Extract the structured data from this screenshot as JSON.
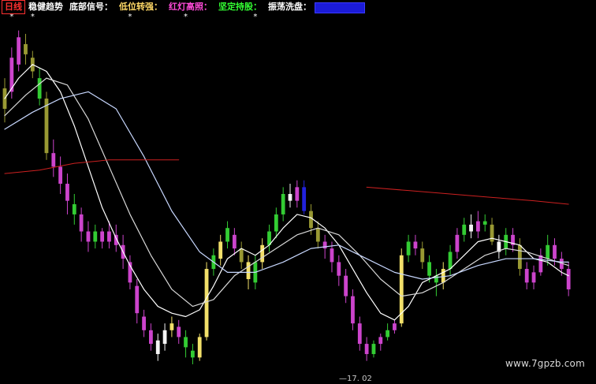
{
  "legend": [
    {
      "label": "日线",
      "color": "#ff3030",
      "box": true
    },
    {
      "label": "稳健趋势",
      "color": "#ffffff"
    },
    {
      "label": "底部信号：",
      "color": "#ffffff"
    },
    {
      "label": "低位转强：",
      "color": "#ffd966"
    },
    {
      "label": "红灯高照：",
      "color": "#ff4ad8"
    },
    {
      "label": "坚定持股：",
      "color": "#33ff33"
    },
    {
      "label": "振荡洗盘：",
      "color": "#ffffff"
    },
    {
      "label": "",
      "color": "#2222ff",
      "filled": true
    }
  ],
  "watermark": "www.7gpzb.com",
  "axis_label": "—17. 02",
  "chart_data": {
    "type": "candlestick",
    "colors": {
      "background": "#000000",
      "ma_white": "#ffffff",
      "ma_light": "#d8d8d8",
      "ma_blue": "#c8d8ff",
      "ma_red": "#cc2020",
      "magenta": "#cc44cc",
      "yellow": "#f2e06a",
      "green": "#33cc33",
      "olive": "#999933",
      "blue": "#2222dd",
      "white_candle": "#f5f5f5"
    },
    "x_range": [
      0,
      150
    ],
    "y_range": [
      0,
      100
    ],
    "candles": [
      {
        "x": 0,
        "o": 75,
        "c": 81,
        "h": 84,
        "l": 71,
        "color": "olive"
      },
      {
        "x": 1,
        "o": 80,
        "c": 90,
        "h": 93,
        "l": 78,
        "color": "magenta"
      },
      {
        "x": 2,
        "o": 88,
        "c": 96,
        "h": 98,
        "l": 86,
        "color": "magenta"
      },
      {
        "x": 3,
        "o": 94,
        "c": 91,
        "h": 97,
        "l": 88,
        "color": "olive"
      },
      {
        "x": 4,
        "o": 90,
        "c": 86,
        "h": 92,
        "l": 84,
        "color": "olive"
      },
      {
        "x": 5,
        "o": 84,
        "c": 78,
        "h": 87,
        "l": 76,
        "color": "green"
      },
      {
        "x": 6,
        "o": 78,
        "c": 62,
        "h": 80,
        "l": 60,
        "color": "olive"
      },
      {
        "x": 7,
        "o": 62,
        "c": 58,
        "h": 66,
        "l": 55,
        "color": "magenta"
      },
      {
        "x": 8,
        "o": 58,
        "c": 53,
        "h": 61,
        "l": 50,
        "color": "magenta"
      },
      {
        "x": 9,
        "o": 53,
        "c": 48,
        "h": 56,
        "l": 44,
        "color": "magenta"
      },
      {
        "x": 10,
        "o": 47,
        "c": 44,
        "h": 50,
        "l": 41,
        "color": "green"
      },
      {
        "x": 11,
        "o": 44,
        "c": 39,
        "h": 46,
        "l": 36,
        "color": "magenta"
      },
      {
        "x": 12,
        "o": 39,
        "c": 36,
        "h": 42,
        "l": 33,
        "color": "magenta"
      },
      {
        "x": 13,
        "o": 36,
        "c": 39,
        "h": 41,
        "l": 34,
        "color": "green"
      },
      {
        "x": 14,
        "o": 39,
        "c": 36,
        "h": 40,
        "l": 34,
        "color": "magenta"
      },
      {
        "x": 15,
        "o": 36,
        "c": 39,
        "h": 42,
        "l": 34,
        "color": "magenta"
      },
      {
        "x": 16,
        "o": 38,
        "c": 35,
        "h": 41,
        "l": 33,
        "color": "magenta"
      },
      {
        "x": 17,
        "o": 35,
        "c": 31,
        "h": 38,
        "l": 28,
        "color": "magenta"
      },
      {
        "x": 18,
        "o": 30,
        "c": 24,
        "h": 32,
        "l": 22,
        "color": "magenta"
      },
      {
        "x": 19,
        "o": 23,
        "c": 15,
        "h": 25,
        "l": 12,
        "color": "magenta"
      },
      {
        "x": 20,
        "o": 14,
        "c": 10,
        "h": 16,
        "l": 8,
        "color": "magenta"
      },
      {
        "x": 21,
        "o": 10,
        "c": 6,
        "h": 12,
        "l": 4,
        "color": "magenta"
      },
      {
        "x": 22,
        "o": 7,
        "c": 3,
        "h": 9,
        "l": 1,
        "color": "white_candle"
      },
      {
        "x": 23,
        "o": 6,
        "c": 10,
        "h": 12,
        "l": 4,
        "color": "white_candle"
      },
      {
        "x": 24,
        "o": 10,
        "c": 12,
        "h": 14,
        "l": 8,
        "color": "yellow"
      },
      {
        "x": 25,
        "o": 11,
        "c": 8,
        "h": 13,
        "l": 6,
        "color": "magenta"
      },
      {
        "x": 26,
        "o": 8,
        "c": 5,
        "h": 10,
        "l": 2,
        "color": "green"
      },
      {
        "x": 27,
        "o": 4,
        "c": 2,
        "h": 6,
        "l": 0,
        "color": "green"
      },
      {
        "x": 28,
        "o": 2,
        "c": 8,
        "h": 9,
        "l": 1,
        "color": "yellow"
      },
      {
        "x": 29,
        "o": 8,
        "c": 28,
        "h": 30,
        "l": 7,
        "color": "yellow"
      },
      {
        "x": 30,
        "o": 28,
        "c": 32,
        "h": 34,
        "l": 26,
        "color": "green"
      },
      {
        "x": 31,
        "o": 31,
        "c": 36,
        "h": 38,
        "l": 29,
        "color": "yellow"
      },
      {
        "x": 32,
        "o": 36,
        "c": 40,
        "h": 42,
        "l": 34,
        "color": "green"
      },
      {
        "x": 33,
        "o": 38,
        "c": 34,
        "h": 40,
        "l": 32,
        "color": "magenta"
      },
      {
        "x": 34,
        "o": 34,
        "c": 30,
        "h": 36,
        "l": 28,
        "color": "olive"
      },
      {
        "x": 35,
        "o": 30,
        "c": 25,
        "h": 32,
        "l": 22,
        "color": "yellow"
      },
      {
        "x": 36,
        "o": 24,
        "c": 30,
        "h": 32,
        "l": 22,
        "color": "green"
      },
      {
        "x": 37,
        "o": 30,
        "c": 35,
        "h": 37,
        "l": 28,
        "color": "yellow"
      },
      {
        "x": 38,
        "o": 35,
        "c": 39,
        "h": 41,
        "l": 33,
        "color": "green"
      },
      {
        "x": 39,
        "o": 39,
        "c": 44,
        "h": 46,
        "l": 37,
        "color": "green"
      },
      {
        "x": 40,
        "o": 44,
        "c": 50,
        "h": 52,
        "l": 42,
        "color": "green"
      },
      {
        "x": 41,
        "o": 50,
        "c": 48,
        "h": 53,
        "l": 46,
        "color": "white_candle"
      },
      {
        "x": 42,
        "o": 48,
        "c": 52,
        "h": 54,
        "l": 46,
        "color": "magenta"
      },
      {
        "x": 43,
        "o": 52,
        "c": 45,
        "h": 54,
        "l": 44,
        "color": "blue"
      },
      {
        "x": 44,
        "o": 45,
        "c": 40,
        "h": 47,
        "l": 38,
        "color": "olive"
      },
      {
        "x": 45,
        "o": 40,
        "c": 36,
        "h": 42,
        "l": 34,
        "color": "olive"
      },
      {
        "x": 46,
        "o": 36,
        "c": 34,
        "h": 38,
        "l": 31,
        "color": "magenta"
      },
      {
        "x": 47,
        "o": 34,
        "c": 30,
        "h": 36,
        "l": 27,
        "color": "magenta"
      },
      {
        "x": 48,
        "o": 30,
        "c": 26,
        "h": 32,
        "l": 23,
        "color": "magenta"
      },
      {
        "x": 49,
        "o": 26,
        "c": 20,
        "h": 28,
        "l": 18,
        "color": "magenta"
      },
      {
        "x": 50,
        "o": 20,
        "c": 12,
        "h": 22,
        "l": 10,
        "color": "magenta"
      },
      {
        "x": 51,
        "o": 12,
        "c": 6,
        "h": 14,
        "l": 4,
        "color": "magenta"
      },
      {
        "x": 52,
        "o": 6,
        "c": 3,
        "h": 8,
        "l": 1,
        "color": "magenta"
      },
      {
        "x": 53,
        "o": 3,
        "c": 6,
        "h": 7,
        "l": 2,
        "color": "green"
      },
      {
        "x": 54,
        "o": 6,
        "c": 8,
        "h": 9,
        "l": 4,
        "color": "magenta"
      },
      {
        "x": 55,
        "o": 8,
        "c": 10,
        "h": 12,
        "l": 7,
        "color": "green"
      },
      {
        "x": 56,
        "o": 10,
        "c": 12,
        "h": 13,
        "l": 9,
        "color": "magenta"
      },
      {
        "x": 57,
        "o": 12,
        "c": 32,
        "h": 34,
        "l": 11,
        "color": "yellow"
      },
      {
        "x": 58,
        "o": 32,
        "c": 36,
        "h": 38,
        "l": 30,
        "color": "green"
      },
      {
        "x": 59,
        "o": 36,
        "c": 34,
        "h": 38,
        "l": 32,
        "color": "magenta"
      },
      {
        "x": 60,
        "o": 34,
        "c": 30,
        "h": 36,
        "l": 28,
        "color": "olive"
      },
      {
        "x": 61,
        "o": 30,
        "c": 26,
        "h": 32,
        "l": 24,
        "color": "green"
      },
      {
        "x": 62,
        "o": 26,
        "c": 24,
        "h": 28,
        "l": 20,
        "color": "green"
      },
      {
        "x": 63,
        "o": 24,
        "c": 28,
        "h": 30,
        "l": 22,
        "color": "yellow"
      },
      {
        "x": 64,
        "o": 28,
        "c": 33,
        "h": 35,
        "l": 26,
        "color": "green"
      },
      {
        "x": 65,
        "o": 33,
        "c": 38,
        "h": 40,
        "l": 31,
        "color": "magenta"
      },
      {
        "x": 66,
        "o": 38,
        "c": 41,
        "h": 43,
        "l": 36,
        "color": "green"
      },
      {
        "x": 67,
        "o": 41,
        "c": 39,
        "h": 44,
        "l": 37,
        "color": "white_candle"
      },
      {
        "x": 68,
        "o": 39,
        "c": 42,
        "h": 45,
        "l": 37,
        "color": "magenta"
      },
      {
        "x": 69,
        "o": 42,
        "c": 41,
        "h": 44,
        "l": 39,
        "color": "green"
      },
      {
        "x": 70,
        "o": 41,
        "c": 36,
        "h": 43,
        "l": 35,
        "color": "olive"
      },
      {
        "x": 71,
        "o": 36,
        "c": 33,
        "h": 38,
        "l": 31,
        "color": "white_candle"
      },
      {
        "x": 72,
        "o": 34,
        "c": 38,
        "h": 40,
        "l": 32,
        "color": "green"
      },
      {
        "x": 73,
        "o": 38,
        "c": 35,
        "h": 40,
        "l": 33,
        "color": "magenta"
      },
      {
        "x": 74,
        "o": 35,
        "c": 28,
        "h": 37,
        "l": 26,
        "color": "olive"
      },
      {
        "x": 75,
        "o": 28,
        "c": 24,
        "h": 30,
        "l": 22,
        "color": "magenta"
      },
      {
        "x": 76,
        "o": 24,
        "c": 27,
        "h": 29,
        "l": 22,
        "color": "magenta"
      },
      {
        "x": 77,
        "o": 27,
        "c": 32,
        "h": 34,
        "l": 26,
        "color": "magenta"
      },
      {
        "x": 78,
        "o": 31,
        "c": 35,
        "h": 38,
        "l": 29,
        "color": "green"
      },
      {
        "x": 79,
        "o": 35,
        "c": 31,
        "h": 37,
        "l": 29,
        "color": "magenta"
      },
      {
        "x": 80,
        "o": 31,
        "c": 28,
        "h": 33,
        "l": 26,
        "color": "magenta"
      },
      {
        "x": 81,
        "o": 28,
        "c": 22,
        "h": 30,
        "l": 20,
        "color": "magenta"
      }
    ],
    "moving_averages": [
      {
        "name": "",
        "color_key": "ma_white",
        "points": [
          [
            0,
            78
          ],
          [
            2,
            84
          ],
          [
            4,
            88
          ],
          [
            6,
            86
          ],
          [
            8,
            80
          ],
          [
            10,
            70
          ],
          [
            12,
            58
          ],
          [
            14,
            46
          ],
          [
            16,
            37
          ],
          [
            18,
            29
          ],
          [
            20,
            22
          ],
          [
            22,
            17
          ],
          [
            24,
            15
          ],
          [
            26,
            14
          ],
          [
            28,
            16
          ],
          [
            30,
            23
          ],
          [
            32,
            31
          ],
          [
            34,
            34
          ],
          [
            36,
            32
          ],
          [
            38,
            35
          ],
          [
            40,
            40
          ],
          [
            42,
            44
          ],
          [
            44,
            43
          ],
          [
            46,
            40
          ],
          [
            48,
            35
          ],
          [
            50,
            28
          ],
          [
            52,
            21
          ],
          [
            54,
            15
          ],
          [
            56,
            13
          ],
          [
            58,
            17
          ],
          [
            60,
            24
          ],
          [
            62,
            26
          ],
          [
            64,
            28
          ],
          [
            66,
            32
          ],
          [
            68,
            36
          ],
          [
            70,
            37
          ],
          [
            72,
            36
          ],
          [
            74,
            35
          ],
          [
            76,
            31
          ],
          [
            78,
            30
          ],
          [
            80,
            27
          ],
          [
            81,
            26
          ]
        ]
      },
      {
        "name": "",
        "color_key": "ma_light",
        "points": [
          [
            0,
            73
          ],
          [
            3,
            79
          ],
          [
            6,
            84
          ],
          [
            9,
            82
          ],
          [
            12,
            72
          ],
          [
            15,
            58
          ],
          [
            18,
            44
          ],
          [
            21,
            32
          ],
          [
            24,
            22
          ],
          [
            27,
            17
          ],
          [
            30,
            19
          ],
          [
            33,
            26
          ],
          [
            36,
            30
          ],
          [
            39,
            34
          ],
          [
            42,
            38
          ],
          [
            45,
            40
          ],
          [
            48,
            38
          ],
          [
            51,
            32
          ],
          [
            54,
            25
          ],
          [
            57,
            20
          ],
          [
            60,
            21
          ],
          [
            63,
            24
          ],
          [
            66,
            28
          ],
          [
            69,
            32
          ],
          [
            72,
            34
          ],
          [
            75,
            33
          ],
          [
            78,
            31
          ],
          [
            81,
            29
          ]
        ]
      },
      {
        "name": "",
        "color_key": "ma_blue",
        "points": [
          [
            0,
            69
          ],
          [
            4,
            74
          ],
          [
            8,
            78
          ],
          [
            12,
            80
          ],
          [
            16,
            75
          ],
          [
            20,
            61
          ],
          [
            24,
            45
          ],
          [
            28,
            33
          ],
          [
            32,
            27
          ],
          [
            36,
            27
          ],
          [
            40,
            30
          ],
          [
            44,
            34
          ],
          [
            48,
            35
          ],
          [
            52,
            31
          ],
          [
            56,
            27
          ],
          [
            60,
            25
          ],
          [
            64,
            26
          ],
          [
            68,
            29
          ],
          [
            72,
            31
          ],
          [
            76,
            31
          ],
          [
            80,
            30
          ],
          [
            81,
            30
          ]
        ]
      },
      {
        "name": "",
        "color_key": "ma_red",
        "points": [
          [
            0,
            56
          ],
          [
            5,
            57
          ],
          [
            10,
            59
          ],
          [
            15,
            60
          ],
          [
            20,
            60
          ],
          [
            25,
            60
          ]
        ]
      },
      {
        "name": "",
        "color_key": "ma_red",
        "points": [
          [
            52,
            52
          ],
          [
            58,
            51
          ],
          [
            64,
            50
          ],
          [
            70,
            49
          ],
          [
            76,
            48
          ],
          [
            81,
            47
          ]
        ]
      }
    ],
    "markers": [
      {
        "x": 1,
        "label": "*",
        "color": "#ffffff"
      },
      {
        "x": 4,
        "label": "*",
        "color": "#ffffff"
      },
      {
        "x": 18,
        "label": "*",
        "color": "#ffffff"
      },
      {
        "x": 26,
        "label": "*",
        "color": "#ffffff"
      },
      {
        "x": 36,
        "label": "*",
        "color": "#ffffff"
      }
    ]
  }
}
